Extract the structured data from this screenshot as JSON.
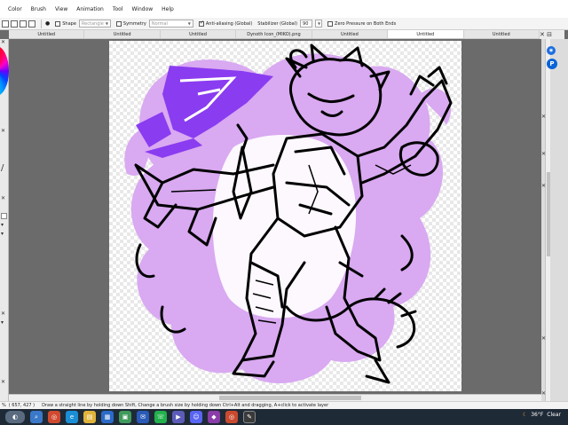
{
  "menu": [
    "Color",
    "Brush",
    "View",
    "Animation",
    "Tool",
    "Window",
    "Help"
  ],
  "toolbar": {
    "shape_label": "Shape",
    "shape_value": "Rectangle",
    "symmetry_label": "Symmetry",
    "symmetry_value": "Normal",
    "antialias_label": "Anti-aliasing (Global)",
    "stabilizer_label": "Stabilizer (Global)",
    "stabilizer_value": "90",
    "zero_pressure_label": "Zero Pressure on Both Ends"
  },
  "tabs": [
    "Untitled",
    "Untitled",
    "Untitled",
    "Dynoth Icon_(MIKO).png",
    "Untitled",
    "Untitled",
    "Untitled"
  ],
  "active_tab_index": 5,
  "tabs_end": "✕ ⊟",
  "status": {
    "coords": "( 657, 427 )",
    "hint": "Draw a straight line by holding down Shift, Change a brush size by holding down Ctrl+Alt and dragging, A+click to activate layer"
  },
  "zoom_prefix": "%",
  "taskbar": {
    "temp": "36°F",
    "condition": "Clear",
    "icons": [
      "start-icon",
      "search-icon",
      "chrome-icon",
      "edge-icon",
      "files-icon",
      "calendar-icon",
      "photos-icon",
      "mail-icon",
      "whatsapp-icon",
      "media-icon",
      "discord-icon",
      "app-icon",
      "chrome-icon",
      "paint-icon"
    ]
  },
  "right_badges": {
    "p_label": "P"
  },
  "colors": {
    "purple_solid": "#8a3cf0",
    "purple_light": "#d7a6f0",
    "accent_blue": "#0a63d8"
  }
}
